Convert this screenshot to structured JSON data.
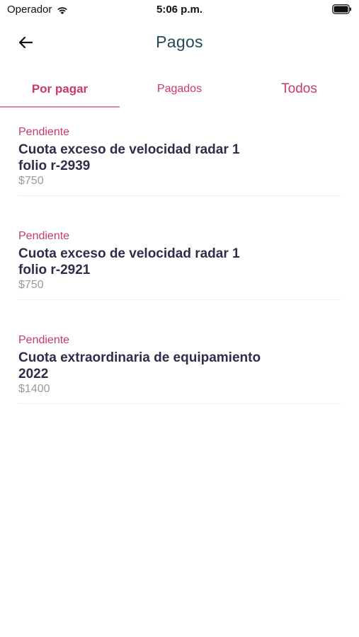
{
  "status_bar": {
    "carrier": "Operador",
    "time": "5:06 p.m."
  },
  "nav": {
    "title": "Pagos"
  },
  "tabs": [
    {
      "label": "Por pagar"
    },
    {
      "label": "Pagados"
    },
    {
      "label": "Todos"
    }
  ],
  "items": [
    {
      "status": "Pendiente",
      "title": "Cuota exceso de velocidad radar 1 folio r-2939",
      "amount": "$750"
    },
    {
      "status": "Pendiente",
      "title": "Cuota exceso de velocidad radar 1 folio r-2921",
      "amount": "$750"
    },
    {
      "status": "Pendiente",
      "title": "Cuota extraordinaria de equipamiento 2022",
      "amount": "$1400"
    }
  ],
  "colors": {
    "accent": "#c93a6a",
    "title": "#1f4b57",
    "item_title": "#2e2d4a",
    "muted": "#9a9a9a"
  }
}
